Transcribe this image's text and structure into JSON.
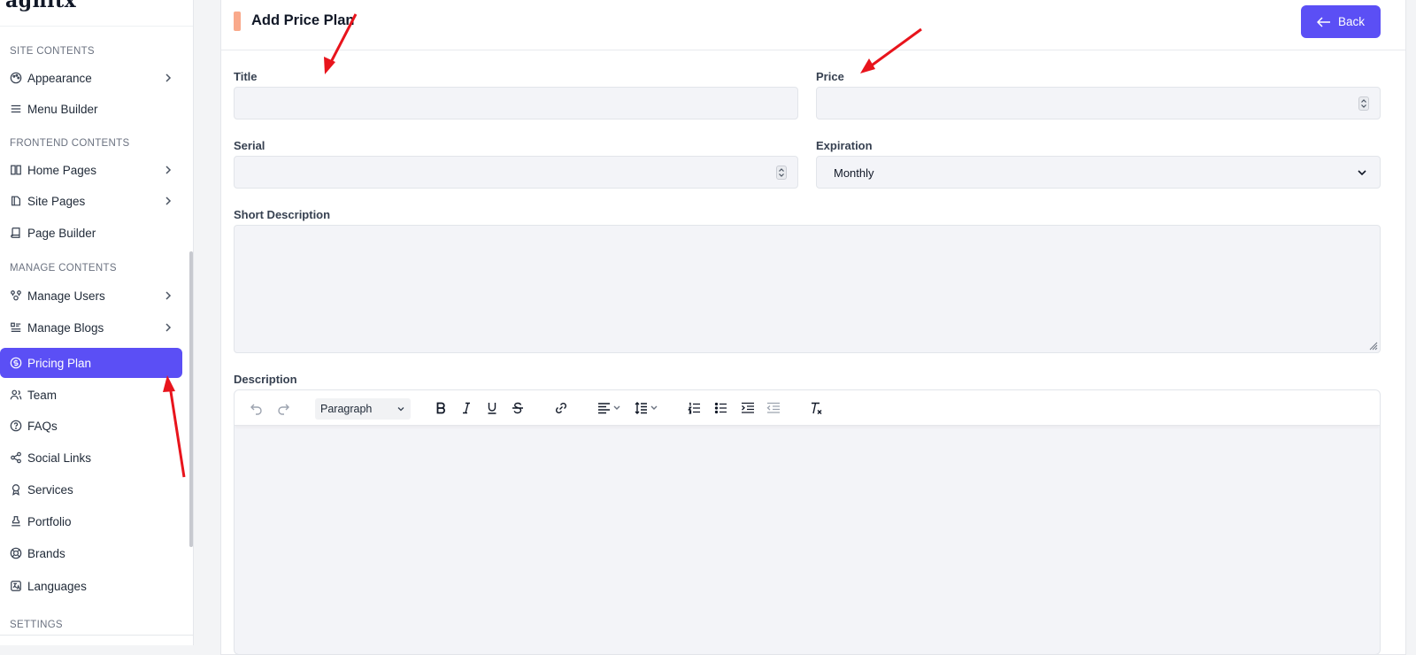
{
  "sidebar": {
    "logo": "agnitx",
    "sections": {
      "site": "SITE CONTENTS",
      "frontend": "FRONTEND CONTENTS",
      "manage": "MANAGE CONTENTS",
      "settings": "SETTINGS"
    },
    "items": {
      "appearance": "Appearance",
      "menu_builder": "Menu Builder",
      "home_pages": "Home Pages",
      "site_pages": "Site Pages",
      "page_builder": "Page Builder",
      "manage_users": "Manage Users",
      "manage_blogs": "Manage Blogs",
      "pricing_plan": "Pricing Plan",
      "team": "Team",
      "faqs": "FAQs",
      "social_links": "Social Links",
      "services": "Services",
      "portfolio": "Portfolio",
      "brands": "Brands",
      "languages": "Languages"
    },
    "active_item": "Pricing Plan"
  },
  "header": {
    "title": "Add Price Plan",
    "back_label": "Back"
  },
  "form": {
    "title_label": "Title",
    "title_value": "",
    "price_label": "Price",
    "price_value": "",
    "serial_label": "Serial",
    "serial_value": "",
    "expiration_label": "Expiration",
    "expiration_value": "Monthly",
    "short_description_label": "Short Description",
    "short_description_value": "",
    "description_label": "Description"
  },
  "editor": {
    "block_format": "Paragraph",
    "buttons": [
      "undo-icon",
      "redo-icon",
      "bold-icon",
      "italic-icon",
      "underline-icon",
      "strikethrough-icon",
      "link-icon",
      "align-left-icon",
      "line-height-icon",
      "numbered-list-icon",
      "bullet-list-icon",
      "indent-icon",
      "outdent-icon",
      "clear-format-icon"
    ]
  },
  "colors": {
    "accent": "#5b4ff5",
    "header_marker": "#f9a98b",
    "annotation_arrow": "#e8141c",
    "field_bg": "#f3f4f8"
  }
}
